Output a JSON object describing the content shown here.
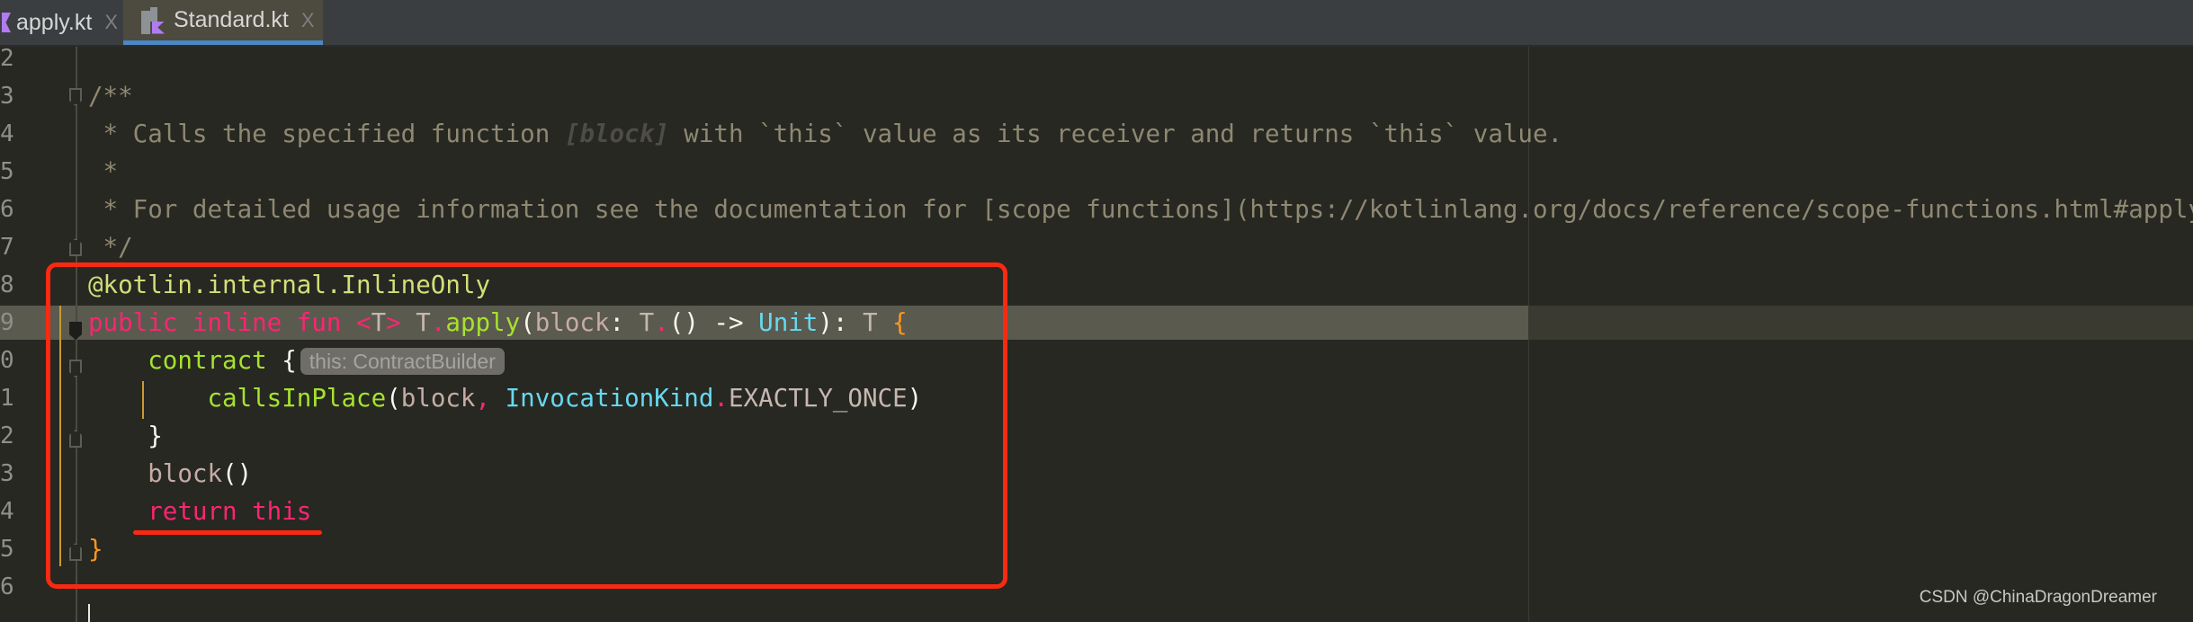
{
  "tabs": [
    {
      "label": "apply.kt",
      "icon": "kotlin-file-icon",
      "close": "X",
      "active": false
    },
    {
      "label": "Standard.kt",
      "icon": "kotlin-library-file-icon",
      "close": "X",
      "active": true
    }
  ],
  "line_numbers": [
    "2",
    "3",
    "4",
    "5",
    "6",
    "7",
    "8",
    "9",
    "0",
    "1",
    "2",
    "3",
    "4",
    "5",
    "6"
  ],
  "current_line_index": 7,
  "code_lines": [
    [],
    [
      {
        "t": "/**",
        "c": "cm"
      }
    ],
    [
      {
        "t": " * Calls the specified function ",
        "c": "cm"
      },
      {
        "t": "[block]",
        "c": "cmb"
      },
      {
        "t": " with `this` value as its receiver and returns `this` value.",
        "c": "cm"
      }
    ],
    [
      {
        "t": " *",
        "c": "cm"
      }
    ],
    [
      {
        "t": " * For detailed usage information see the documentation for [scope functions](https://kotlinlang.org/docs/reference/scope-functions.html#apply).",
        "c": "cm"
      }
    ],
    [
      {
        "t": " */",
        "c": "cm"
      }
    ],
    [
      {
        "t": "@kotlin.internal.InlineOnly",
        "c": "ann"
      }
    ],
    [
      {
        "t": "public inline fun ",
        "c": "kw"
      },
      {
        "t": "<",
        "c": "kw"
      },
      {
        "t": "T",
        "c": "tp"
      },
      {
        "t": "> ",
        "c": "kw"
      },
      {
        "t": "T",
        "c": "tp"
      },
      {
        "t": ".",
        "c": "kw"
      },
      {
        "t": "apply",
        "c": "fn"
      },
      {
        "t": "(",
        "c": "pl"
      },
      {
        "t": "block",
        "c": "pa"
      },
      {
        "t": ": ",
        "c": "pl"
      },
      {
        "t": "T",
        "c": "tp"
      },
      {
        "t": ".",
        "c": "kw"
      },
      {
        "t": "() -> ",
        "c": "pl"
      },
      {
        "t": "Unit",
        "c": "ty"
      },
      {
        "t": "): ",
        "c": "pl"
      },
      {
        "t": "T ",
        "c": "tp"
      },
      {
        "t": "{",
        "c": "br"
      }
    ],
    [
      {
        "t": "    contract ",
        "c": "fn"
      },
      {
        "t": "{",
        "c": "pl"
      },
      {
        "hint": "this: ContractBuilder"
      }
    ],
    [
      {
        "t": "        callsInPlace",
        "c": "fn"
      },
      {
        "t": "(",
        "c": "pl"
      },
      {
        "t": "block",
        "c": "pa"
      },
      {
        "t": ", ",
        "c": "kw"
      },
      {
        "t": "InvocationKind",
        "c": "ty"
      },
      {
        "t": ".",
        "c": "kw"
      },
      {
        "t": "EXACTLY_ONCE",
        "c": "tp"
      },
      {
        "t": ")",
        "c": "pl"
      }
    ],
    [
      {
        "t": "    }",
        "c": "pl"
      }
    ],
    [
      {
        "t": "    block",
        "c": "pa"
      },
      {
        "t": "()",
        "c": "pl"
      }
    ],
    [
      {
        "t": "    return this",
        "c": "kw"
      }
    ],
    [
      {
        "t": "}",
        "c": "br"
      }
    ],
    []
  ],
  "watermark": "CSDN @ChinaDragonDreamer",
  "colors": {
    "background": "#272822",
    "keyword": "#f92672",
    "function": "#a6e22e",
    "type": "#66d9ef",
    "brace": "#fd971f",
    "annotation_box": "#f92a12",
    "tab_underline": "#4a88c7"
  }
}
